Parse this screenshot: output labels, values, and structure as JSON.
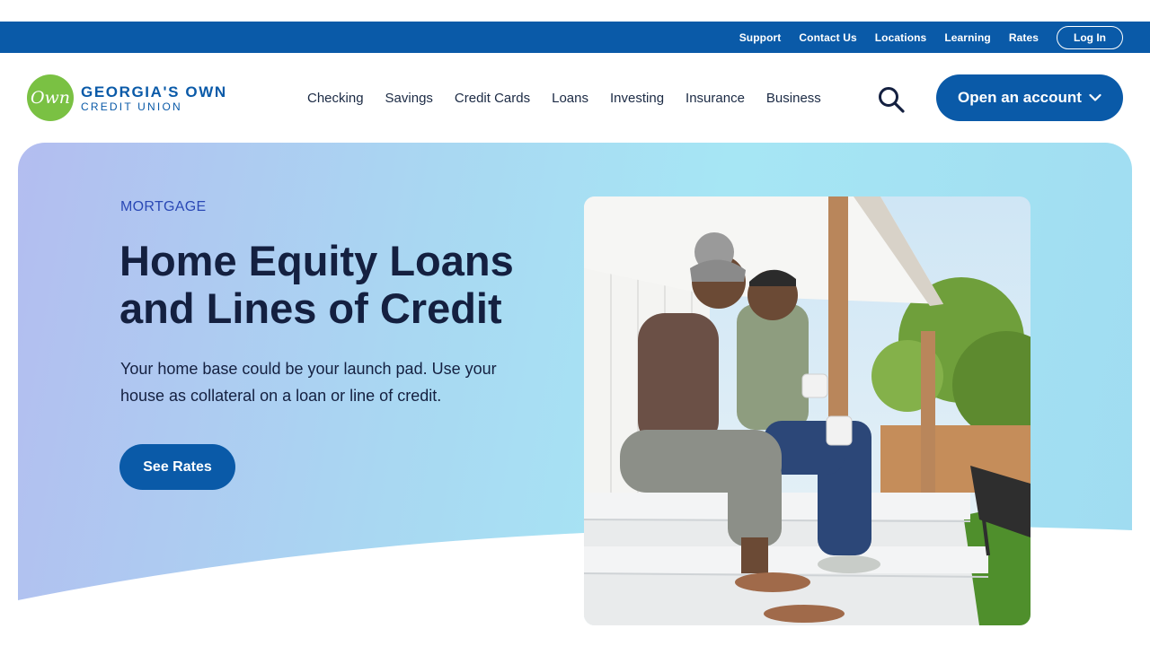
{
  "utility_nav": {
    "links": [
      "Support",
      "Contact Us",
      "Locations",
      "Learning",
      "Rates"
    ],
    "login_label": "Log In"
  },
  "brand": {
    "badge_text": "Own",
    "name_line1": "GEORGIA'S OWN",
    "name_line2": "CREDIT UNION",
    "colors": {
      "primary": "#0a5aa8",
      "badge": "#7ac143"
    }
  },
  "main_nav": {
    "links": [
      "Checking",
      "Savings",
      "Credit Cards",
      "Loans",
      "Investing",
      "Insurance",
      "Business"
    ],
    "search_icon": "search-icon",
    "cta_label": "Open an account"
  },
  "hero": {
    "eyebrow": "MORTGAGE",
    "title": "Home Equity Loans and Lines of Credit",
    "description": "Your home base could be your launch pad. Use your house as collateral on a loan or line of credit.",
    "button_label": "See Rates",
    "image": "photo of an older couple sitting on porch steps holding mugs"
  }
}
